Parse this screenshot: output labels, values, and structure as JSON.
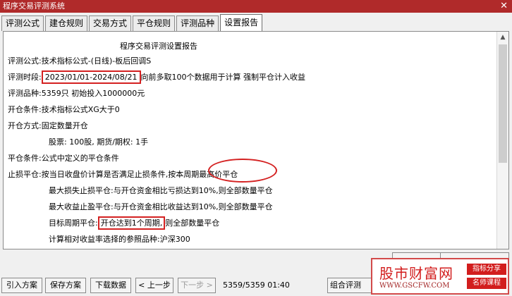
{
  "window": {
    "title": "程序交易评测系统",
    "close_glyph": "✕"
  },
  "tabs": [
    {
      "label": "评测公式",
      "active": false
    },
    {
      "label": "建仓规则",
      "active": false
    },
    {
      "label": "交易方式",
      "active": false
    },
    {
      "label": "平仓规则",
      "active": false
    },
    {
      "label": "评测品种",
      "active": false
    },
    {
      "label": "设置报告",
      "active": true
    }
  ],
  "report": {
    "title": "程序交易评测设置报告",
    "formula": {
      "label": "评测公式:",
      "value": "技术指标公式-(日线)-板后回调S"
    },
    "period": {
      "label": "评测时段:",
      "date_range": "2023/01/01-2024/08/21",
      "rest": "向前多取100个数据用于计算 强制平仓计入收益"
    },
    "varieties": {
      "label": "评测品种:",
      "value": "5359只 初始投入1000000元"
    },
    "open_cond": {
      "label": "开仓条件:",
      "value": "技术指标公式XG大于0"
    },
    "open_mode": {
      "label": "开仓方式:",
      "value": "固定数量开仓"
    },
    "shares": {
      "value": "股票: 100股, 期货/期权: 1手"
    },
    "close_cond": {
      "label": "平仓条件:",
      "value": "公式中定义的平仓条件"
    },
    "stop_loss": {
      "label": "止损平仓:",
      "value": "按当日收盘价计算是否满足止损条件,按本周期最高价平仓"
    },
    "max_loss": {
      "label": "最大损失止损平仓:",
      "value": "与开仓资金相比亏损达到10%,则全部数量平仓"
    },
    "max_profit": {
      "label": "最大收益止盈平仓:",
      "value": "与开仓资金相比收益达到10%,则全部数量平仓"
    },
    "target_cycle": {
      "label": "目标周期平仓:",
      "boxed": "开仓达到1个周期,",
      "rest": "则全部数量平仓"
    },
    "benchmark": {
      "label": "计算相对收益率选择的参照品种:",
      "value": "沪深300"
    }
  },
  "bottom": {
    "import_btn": "引入方案",
    "save_btn": "保存方案",
    "download_btn": "下载数据",
    "prev_btn": "< 上一步",
    "next_btn": "下一步 >",
    "status": "5359/5359 01:40",
    "combo": "组合评测"
  },
  "watermark": {
    "name": "股市财富网",
    "url": "WWW.GSCFW.COM",
    "badge1": "指标分享",
    "badge2": "名师课程"
  },
  "colors": {
    "titlebar": "#b02a2a",
    "highlight": "#d42121",
    "panel": "#ffffff"
  },
  "icons": {
    "scroll_up": "up-arrow-icon",
    "close": "close-icon"
  }
}
